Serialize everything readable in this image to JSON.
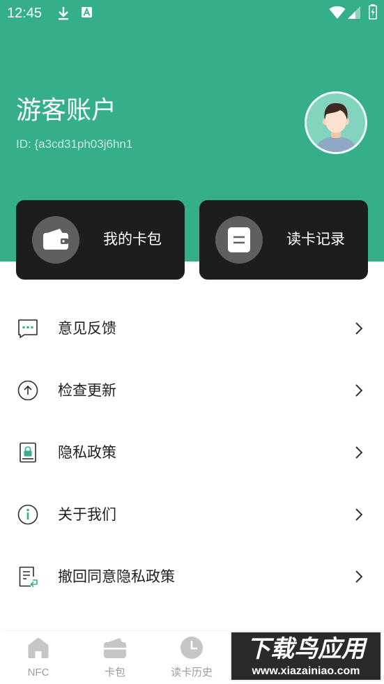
{
  "status_bar": {
    "time": "12:45",
    "icons": [
      "download-icon",
      "a-notification-icon",
      "wifi-icon",
      "signal-icon",
      "battery-icon"
    ]
  },
  "header": {
    "title": "游客账户",
    "user_id": "ID: {a3cd31ph03j6hn1",
    "avatar_icon": "avatar"
  },
  "cards": [
    {
      "label": "我的卡包",
      "icon": "wallet-icon"
    },
    {
      "label": "读卡记录",
      "icon": "document-icon"
    }
  ],
  "menu": {
    "items": [
      {
        "label": "意见反馈",
        "icon": "feedback-icon"
      },
      {
        "label": "检查更新",
        "icon": "update-icon"
      },
      {
        "label": "隐私政策",
        "icon": "privacy-lock-icon"
      },
      {
        "label": "关于我们",
        "icon": "info-icon"
      },
      {
        "label": "撤回同意隐私政策",
        "icon": "withdraw-consent-icon"
      }
    ]
  },
  "bottom_nav": {
    "items": [
      {
        "label": "NFC",
        "icon": "home-icon"
      },
      {
        "label": "卡包",
        "icon": "wallet-icon"
      },
      {
        "label": "读卡历史",
        "icon": "clock-icon"
      }
    ]
  },
  "watermark": {
    "title": "下载鸟应用",
    "url": "www.xiazainiao.com"
  },
  "colors": {
    "primary": "#35ae8b",
    "card_bg": "#1c1e1e",
    "icon_circle": "#5e6060",
    "nav_gray": "#9c9c9c"
  }
}
